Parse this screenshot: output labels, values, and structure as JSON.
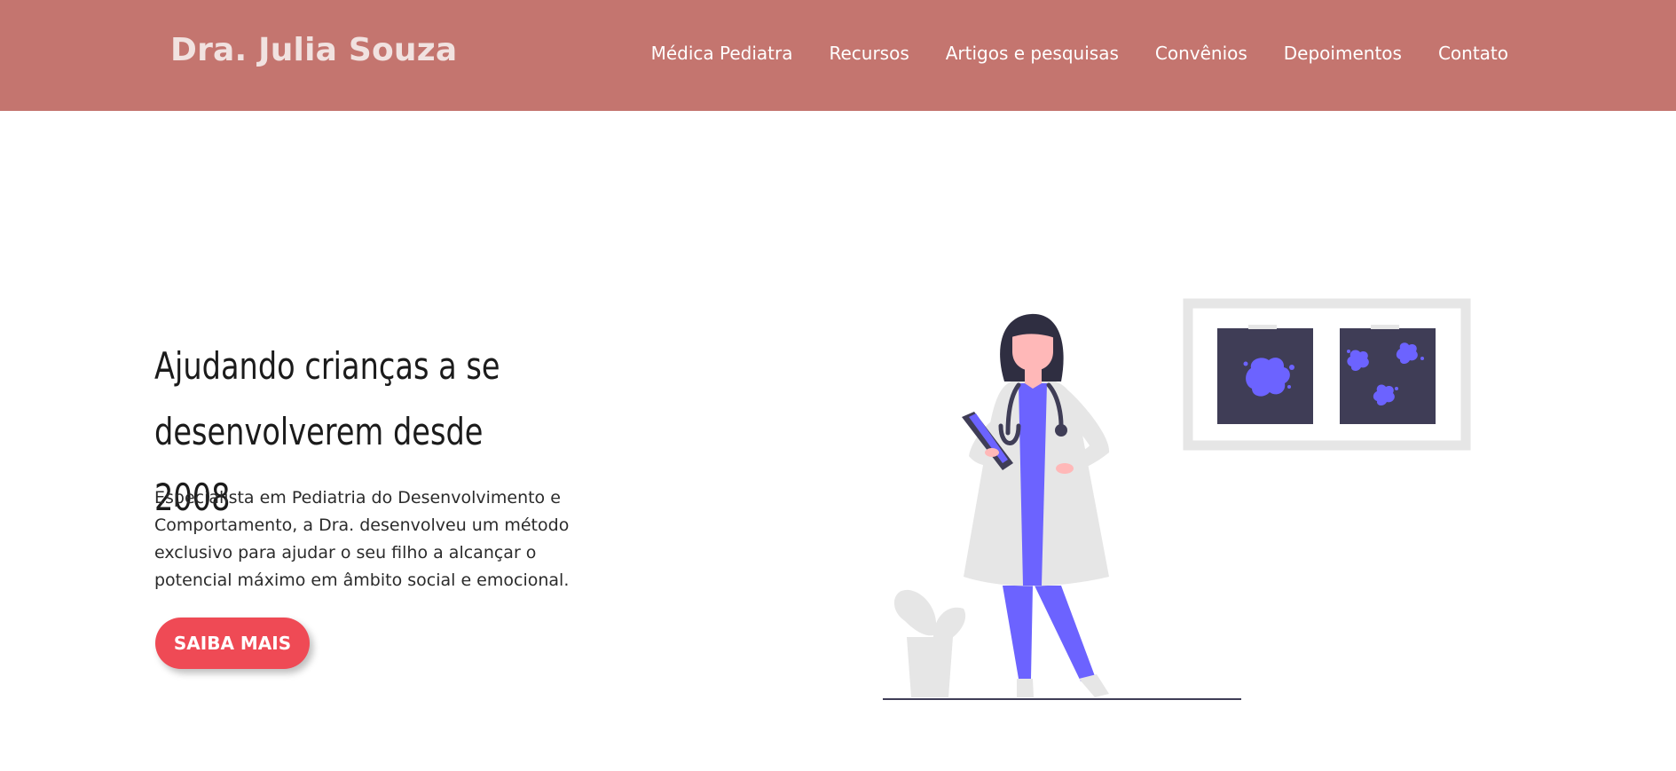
{
  "header": {
    "brand": "Dra. Julia Souza",
    "nav": [
      "Médica Pediatra",
      "Recursos",
      "Artigos e pesquisas",
      "Convênios",
      "Depoimentos",
      "Contato"
    ]
  },
  "hero": {
    "title_line1": "Ajudando crianças a se",
    "title_line2": "desenvolverem desde 2008",
    "text_line1": "Especialista em Pediatria do Desenvolvimento e",
    "text_line2": "Comportamento, a Dra. desenvolveu um método",
    "text_line3": "exclusivo para ajudar o seu filho a alcançar o",
    "text_line4": "potencial máximo em âmbito social e emocional.",
    "cta_label": "SAIBA MAIS"
  },
  "colors": {
    "header_bg": "#c4756f",
    "brand_text": "#f1e2e0",
    "cta_bg": "#ef4a55",
    "accent_purple": "#6c63ff",
    "xray_dark": "#3f3d56",
    "light_gray": "#e6e6e6"
  },
  "illustration": {
    "subject": "doctor-illustration"
  }
}
